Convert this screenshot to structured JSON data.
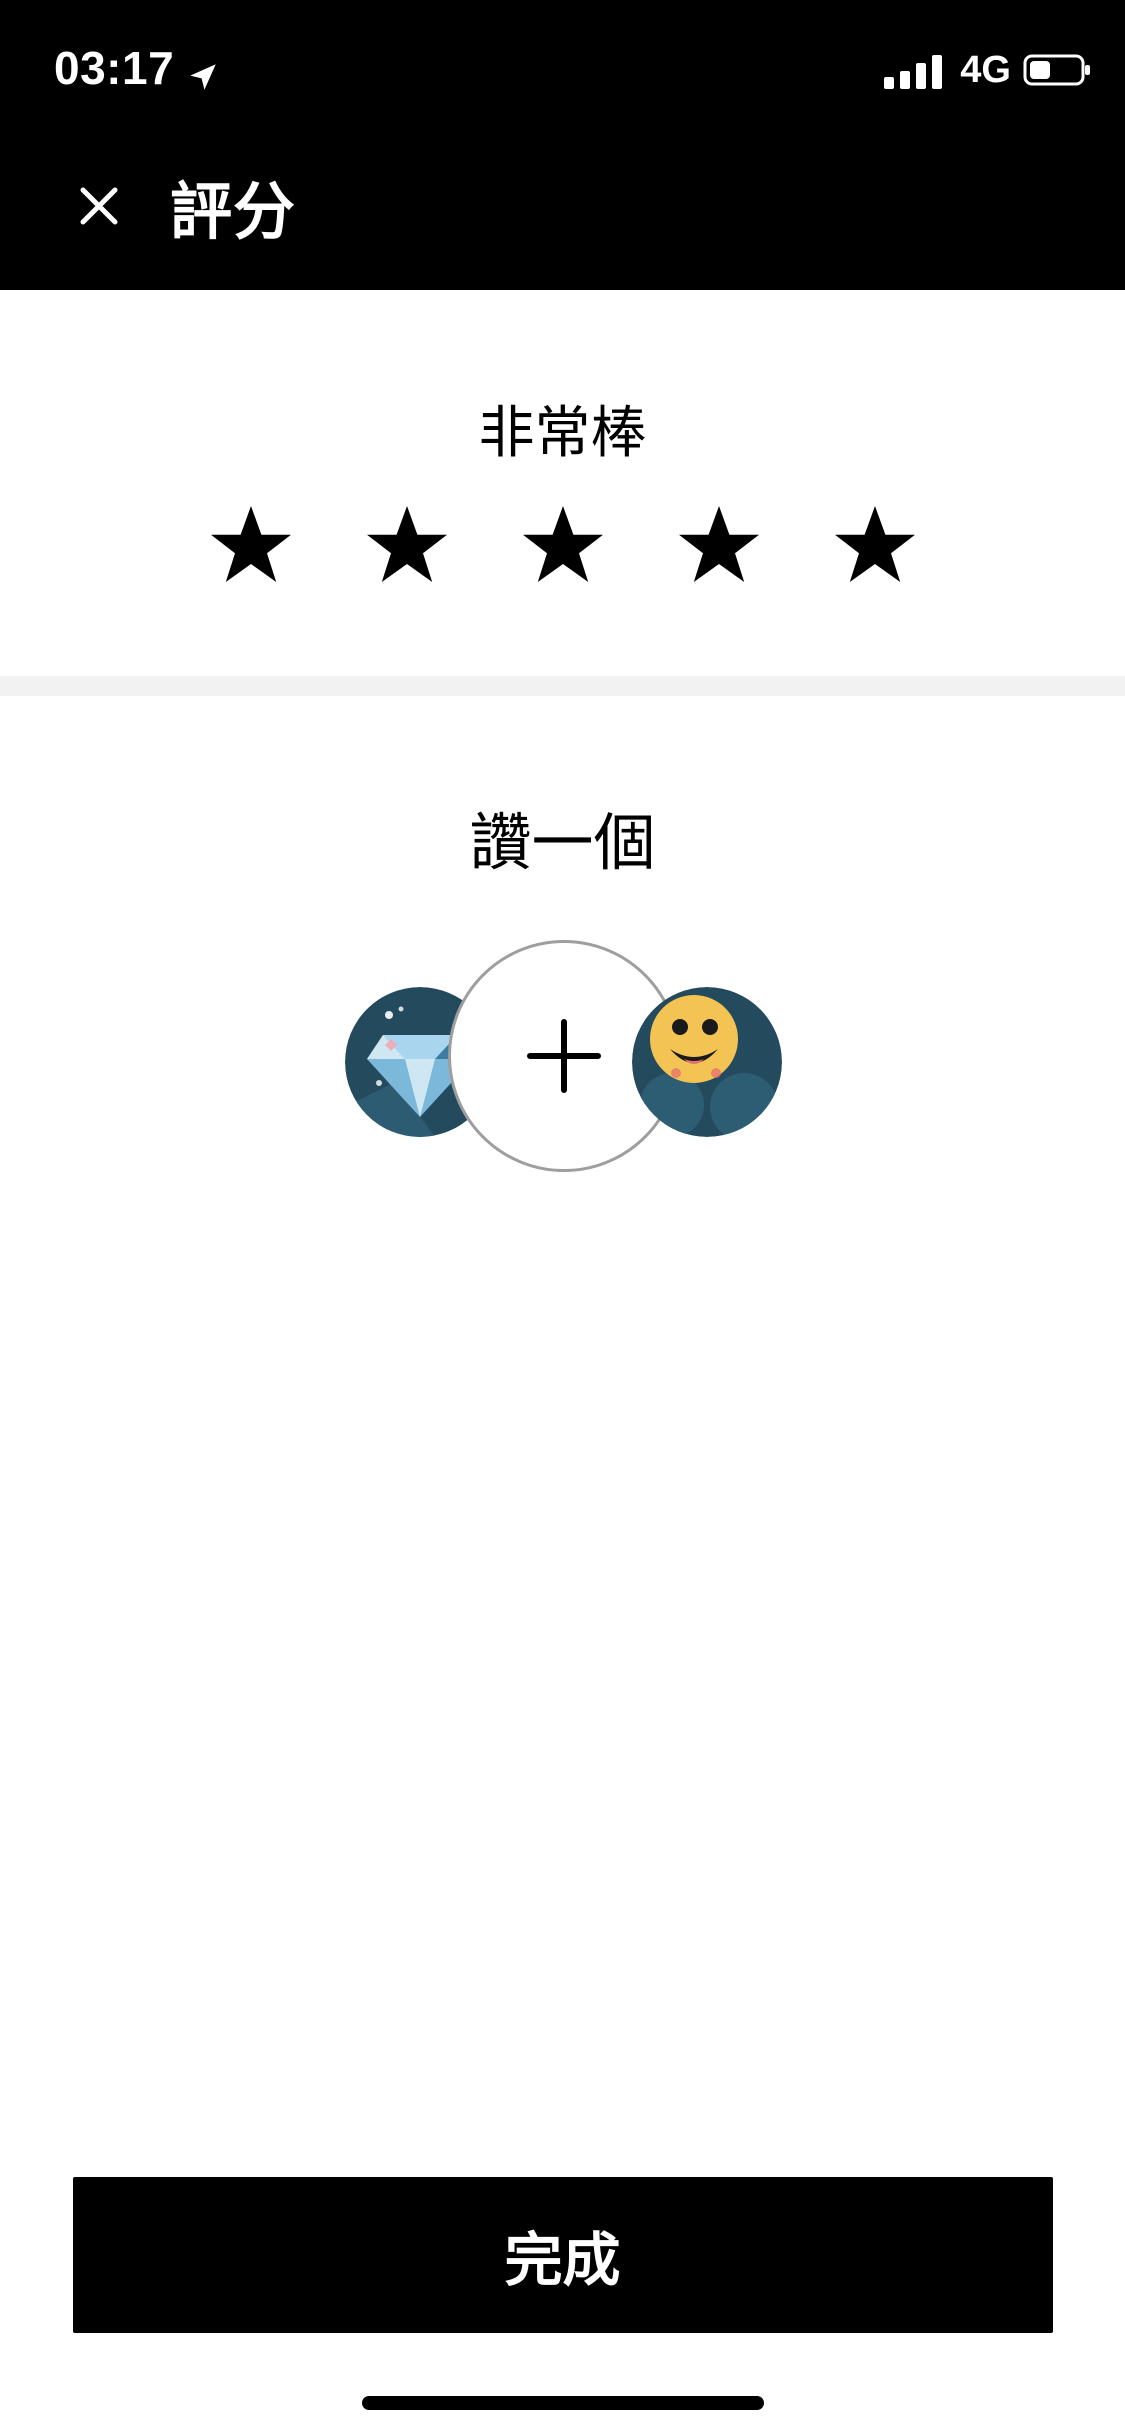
{
  "status_bar": {
    "time": "03:17",
    "network": "4G",
    "location_icon": "location-arrow-icon",
    "signal_icon": "signal-bars-icon",
    "battery_icon": "battery-icon"
  },
  "header": {
    "title": "評分",
    "close_icon": "close-icon"
  },
  "rating": {
    "label": "非常棒",
    "stars": 5,
    "selected": 5
  },
  "compliment": {
    "label": "讚一個",
    "items": [
      {
        "icon": "diamond-badge-icon"
      },
      {
        "icon": "add-icon"
      },
      {
        "icon": "happy-face-badge-icon"
      }
    ]
  },
  "footer": {
    "done_label": "完成"
  },
  "colors": {
    "primary": "#000000",
    "background": "#ffffff",
    "divider": "#f2f2f2",
    "badge_bg": "#244a5e",
    "diamond_light": "#cfe7f3",
    "diamond_mid": "#7cb8d9",
    "diamond_dark": "#3b7ca0",
    "face_yellow": "#f3c453"
  }
}
